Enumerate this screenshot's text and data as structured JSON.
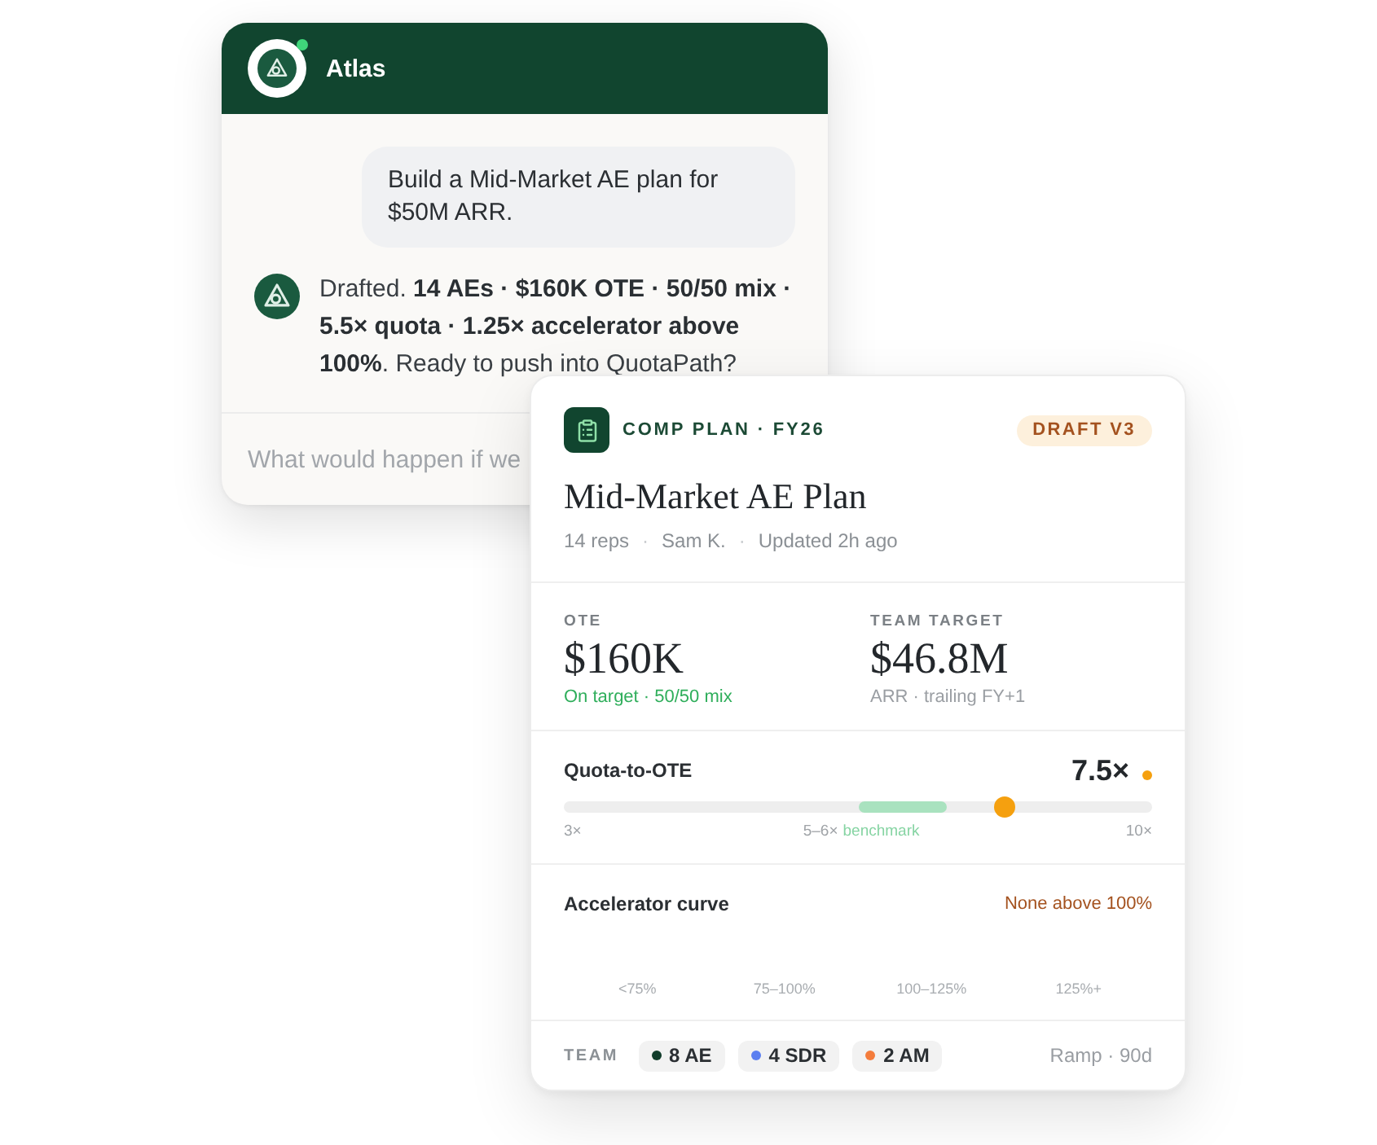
{
  "chat": {
    "assistant": {
      "name": "Atlas",
      "online": true
    },
    "messages": [
      {
        "kind": "user",
        "text": "Build a Mid-Market AE plan for $50M ARR."
      },
      {
        "kind": "assistant",
        "text": "Drafted. **14 AEs · $160K OTE · 50/50 mix · 5.5× quota · 1.25× accelerator above 100%**. Ready to push into QuotaPath?"
      }
    ],
    "input": {
      "placeholder": "What would happen if we"
    }
  },
  "plan_card": {
    "kicker": "COMP PLAN · FY26",
    "badge": "DRAFT V3",
    "title": "Mid-Market AE Plan",
    "meta": [
      "14 reps",
      "Sam K.",
      "Updated 2h ago"
    ],
    "meta_separator": "·",
    "stats": [
      {
        "label": "OTE",
        "value": "$160K",
        "note": "On target · 50/50 mix",
        "positive": true
      },
      {
        "label": "TEAM TARGET",
        "value": "$46.8M",
        "note": "ARR · trailing FY+1",
        "positive": false
      }
    ],
    "quota": {
      "label": "Quota-to-OTE",
      "value": "7.5×",
      "level": 0.75,
      "scale_min": "3×",
      "benchmark_range": "5–6×",
      "benchmark_label": "benchmark",
      "scale_max": "10×"
    },
    "accelerator": {
      "title": "Accelerator curve",
      "note": "None above 100%",
      "tiers": [
        "<75%",
        "75–100%",
        "100–125%",
        "125%+"
      ]
    },
    "team": {
      "label": "TEAM",
      "members": [
        {
          "label": "8 AE",
          "color": "#123d2b"
        },
        {
          "label": "4 SDR",
          "color": "#5b7ff0"
        },
        {
          "label": "2 AM",
          "color": "#f47c3c"
        }
      ],
      "ramp": "Ramp · 90d"
    }
  }
}
